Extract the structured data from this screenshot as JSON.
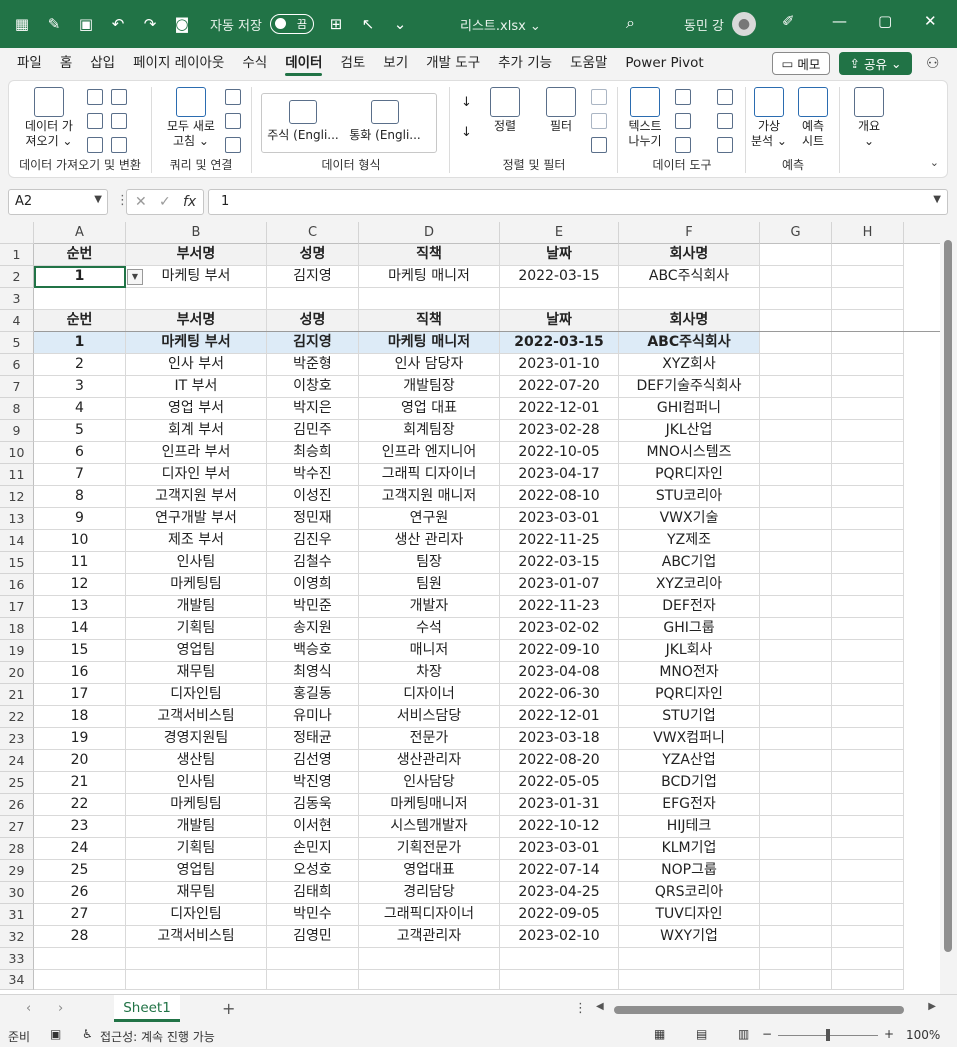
{
  "titlebar": {
    "autosave_label": "자동 저장",
    "autosave_state": "끔",
    "filename": "리스트.xlsx ⌄",
    "user": "동민 강"
  },
  "menu": [
    "파일",
    "홈",
    "삽입",
    "페이지 레이아웃",
    "수식",
    "데이터",
    "검토",
    "보기",
    "개발 도구",
    "추가 기능",
    "도움말",
    "Power Pivot"
  ],
  "menu_active": "데이터",
  "memo_label": "메모",
  "share_label": "공유",
  "ribbon": {
    "get_data": "데이터 가져오기 ⌄",
    "get_data_l1": "데이터 가",
    "get_data_l2": "져오기 ⌄",
    "g1_label": "데이터 가져오기 및 변환",
    "refresh_l1": "모두 새로",
    "refresh_l2": "고침 ⌄",
    "g2_label": "쿼리 및 연결",
    "stocks": "주식 (Engli...",
    "currency": "통화 (Engli...",
    "g3_label": "데이터 형식",
    "sort": "정렬",
    "filter": "필터",
    "g4_label": "정렬 및 필터",
    "text_l1": "텍스트",
    "text_l2": "나누기",
    "g5_label": "데이터 도구",
    "whatif_l1": "가상",
    "whatif_l2": "분석 ⌄",
    "forecast_l1": "예측",
    "forecast_l2": "시트",
    "g6_label": "예측",
    "outline_l1": "개요",
    "outline_l2": "⌄"
  },
  "formula_bar": {
    "name_box": "A2",
    "fx": "fx",
    "formula": "1"
  },
  "columns": [
    "A",
    "B",
    "C",
    "D",
    "E",
    "F",
    "G",
    "H"
  ],
  "rows": [
    "1",
    "2",
    "3",
    "4",
    "5",
    "6",
    "7",
    "8",
    "9",
    "10",
    "11",
    "12",
    "13",
    "14",
    "15",
    "16",
    "17",
    "18",
    "19",
    "20",
    "21",
    "22",
    "23",
    "24",
    "25",
    "26",
    "27",
    "28",
    "29",
    "30",
    "31",
    "32",
    "33",
    "34"
  ],
  "header_labels": [
    "순번",
    "부서명",
    "성명",
    "직책",
    "날짜",
    "회사명"
  ],
  "lookup_row": [
    "1",
    "마케팅 부서",
    "김지영",
    "마케팅 매니저",
    "2022-03-15",
    "ABC주식회사"
  ],
  "table_rows": [
    [
      "1",
      "마케팅 부서",
      "김지영",
      "마케팅 매니저",
      "2022-03-15",
      "ABC주식회사"
    ],
    [
      "2",
      "인사 부서",
      "박준형",
      "인사 담당자",
      "2023-01-10",
      "XYZ회사"
    ],
    [
      "3",
      "IT 부서",
      "이창호",
      "개발팀장",
      "2022-07-20",
      "DEF기술주식회사"
    ],
    [
      "4",
      "영업 부서",
      "박지은",
      "영업 대표",
      "2022-12-01",
      "GHI컴퍼니"
    ],
    [
      "5",
      "회계 부서",
      "김민주",
      "회계팀장",
      "2023-02-28",
      "JKL산업"
    ],
    [
      "6",
      "인프라 부서",
      "최승희",
      "인프라 엔지니어",
      "2022-10-05",
      "MNO시스템즈"
    ],
    [
      "7",
      "디자인 부서",
      "박수진",
      "그래픽 디자이너",
      "2023-04-17",
      "PQR디자인"
    ],
    [
      "8",
      "고객지원 부서",
      "이성진",
      "고객지원 매니저",
      "2022-08-10",
      "STU코리아"
    ],
    [
      "9",
      "연구개발 부서",
      "정민재",
      "연구원",
      "2023-03-01",
      "VWX기술"
    ],
    [
      "10",
      "제조 부서",
      "김진우",
      "생산 관리자",
      "2022-11-25",
      "YZ제조"
    ],
    [
      "11",
      "인사팀",
      "김철수",
      "팀장",
      "2022-03-15",
      "ABC기업"
    ],
    [
      "12",
      "마케팅팀",
      "이영희",
      "팀원",
      "2023-01-07",
      "XYZ코리아"
    ],
    [
      "13",
      "개발팀",
      "박민준",
      "개발자",
      "2022-11-23",
      "DEF전자"
    ],
    [
      "14",
      "기획팀",
      "송지원",
      "수석",
      "2023-02-02",
      "GHI그룹"
    ],
    [
      "15",
      "영업팀",
      "백승호",
      "매니저",
      "2022-09-10",
      "JKL회사"
    ],
    [
      "16",
      "재무팀",
      "최영식",
      "차장",
      "2023-04-08",
      "MNO전자"
    ],
    [
      "17",
      "디자인팀",
      "홍길동",
      "디자이너",
      "2022-06-30",
      "PQR디자인"
    ],
    [
      "18",
      "고객서비스팀",
      "유미나",
      "서비스담당",
      "2022-12-01",
      "STU기업"
    ],
    [
      "19",
      "경영지원팀",
      "정태균",
      "전문가",
      "2023-03-18",
      "VWX컴퍼니"
    ],
    [
      "20",
      "생산팀",
      "김선영",
      "생산관리자",
      "2022-08-20",
      "YZA산업"
    ],
    [
      "21",
      "인사팀",
      "박진영",
      "인사담당",
      "2022-05-05",
      "BCD기업"
    ],
    [
      "22",
      "마케팅팀",
      "김동욱",
      "마케팅매니저",
      "2023-01-31",
      "EFG전자"
    ],
    [
      "23",
      "개발팀",
      "이서현",
      "시스템개발자",
      "2022-10-12",
      "HIJ테크"
    ],
    [
      "24",
      "기획팀",
      "손민지",
      "기획전문가",
      "2023-03-01",
      "KLM기업"
    ],
    [
      "25",
      "영업팀",
      "오성호",
      "영업대표",
      "2022-07-14",
      "NOP그룹"
    ],
    [
      "26",
      "재무팀",
      "김태희",
      "경리담당",
      "2023-04-25",
      "QRS코리아"
    ],
    [
      "27",
      "디자인팀",
      "박민수",
      "그래픽디자이너",
      "2022-09-05",
      "TUV디자인"
    ],
    [
      "28",
      "고객서비스팀",
      "김영민",
      "고객관리자",
      "2023-02-10",
      "WXY기업"
    ]
  ],
  "sheet_tab": "Sheet1",
  "status": {
    "ready": "준비",
    "accessibility": "접근성: 계속 진행 가능",
    "zoom": "100%"
  }
}
